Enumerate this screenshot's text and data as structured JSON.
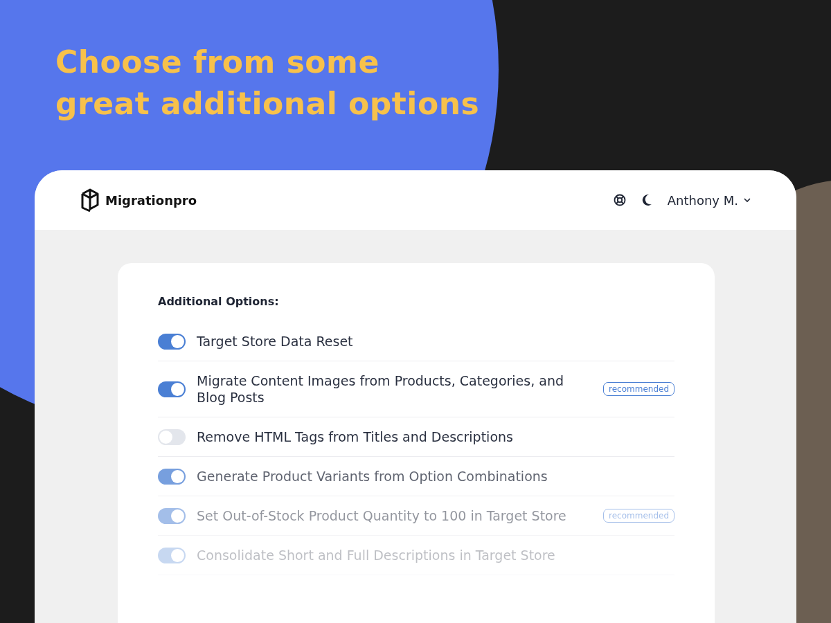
{
  "headline": [
    "Choose from some",
    "great additional options"
  ],
  "header": {
    "brand": "Migrationpro",
    "user": "Anthony M."
  },
  "options_panel": {
    "title": "Additional Options:",
    "options": [
      {
        "label": "Target Store Data Reset",
        "on": true
      },
      {
        "label": "Migrate Content Images from Products, Categories, and Blog Posts",
        "on": true,
        "badge": "recommended"
      },
      {
        "label": "Remove HTML Tags from Titles and Descriptions",
        "on": false
      },
      {
        "label": "Generate Product Variants from Option Combinations",
        "on": true
      },
      {
        "label": "Set Out-of-Stock Product Quantity to 100 in Target Store",
        "on": true,
        "badge": "recommended"
      },
      {
        "label": "Consolidate Short and Full Descriptions in Target Store",
        "on": true
      }
    ]
  }
}
